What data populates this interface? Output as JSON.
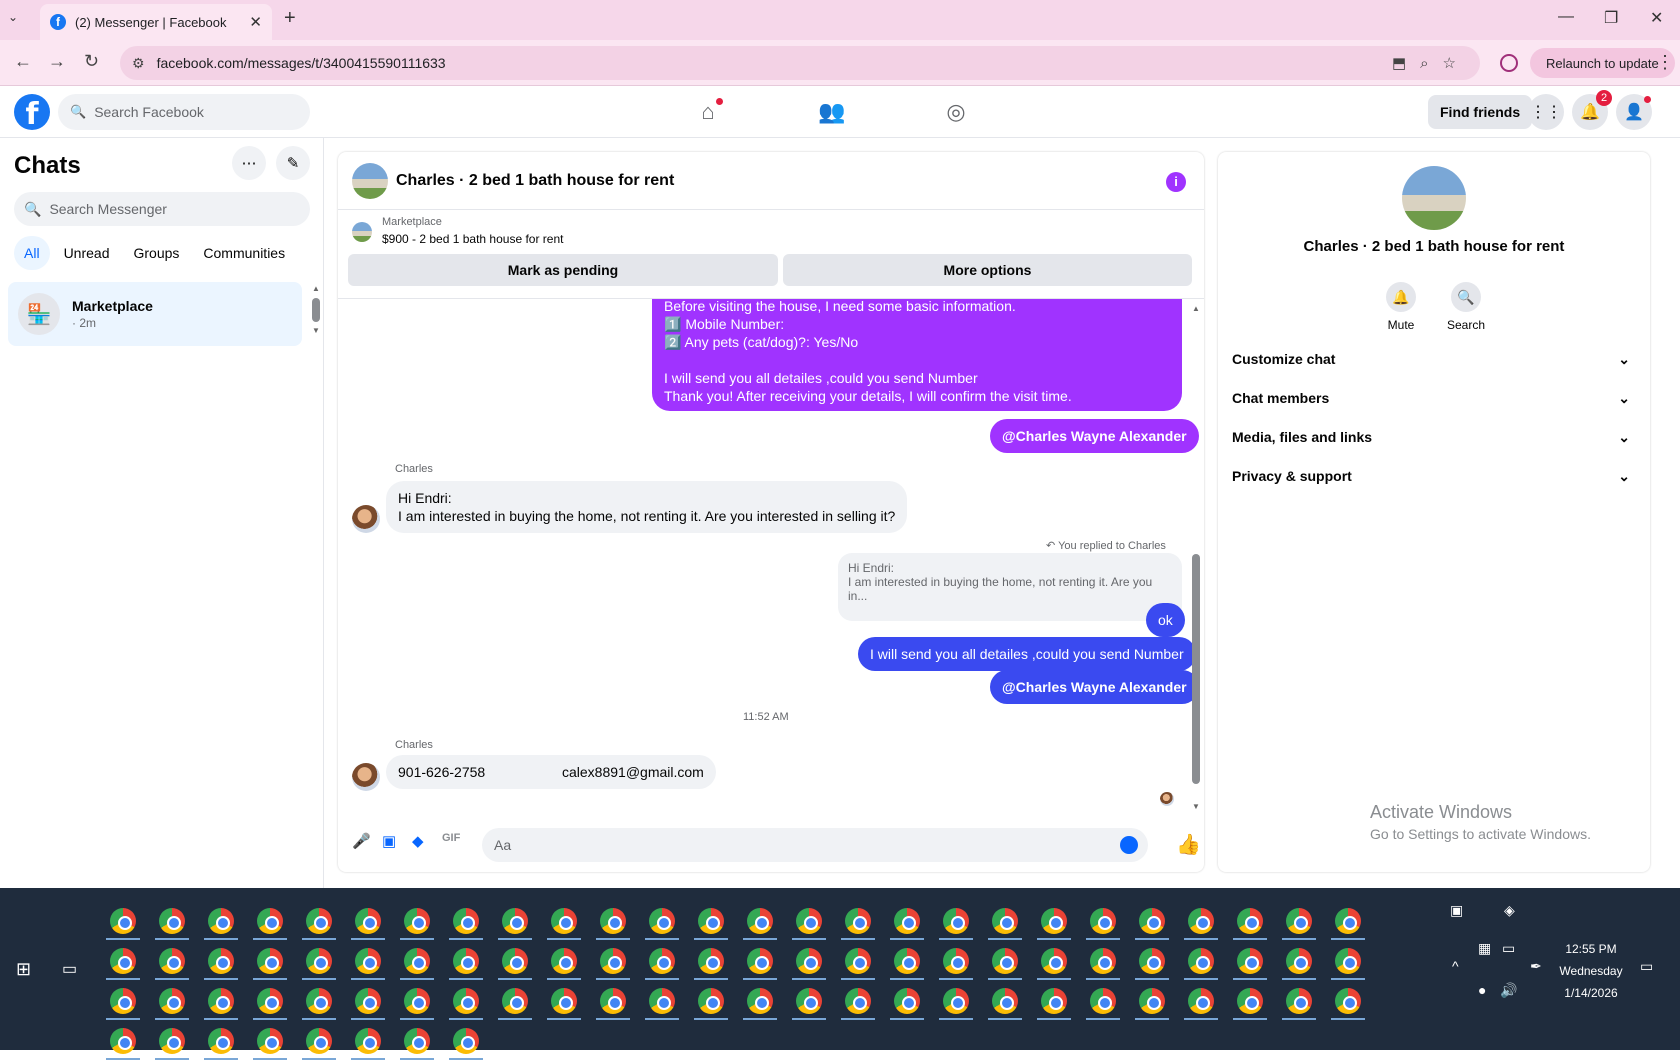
{
  "browser": {
    "tab_title": "(2) Messenger | Facebook",
    "url": "facebook.com/messages/t/3400415590111633",
    "relaunch_label": "Relaunch to update"
  },
  "fb": {
    "search_placeholder": "Search Facebook",
    "find_friends": "Find friends",
    "notification_count": "2"
  },
  "chats": {
    "title": "Chats",
    "search_placeholder": "Search Messenger",
    "filters": [
      "All",
      "Unread",
      "Groups",
      "Communities"
    ],
    "active_filter": "All",
    "items": [
      {
        "name": "Marketplace",
        "time": "· 2m"
      }
    ]
  },
  "conversation": {
    "title": "Charles · 2 bed 1 bath house for rent",
    "marketplace_label": "Marketplace",
    "listing": "$900 - 2 bed 1 bath house for rent",
    "mark_pending": "Mark as pending",
    "more_options": "More options",
    "messages": {
      "out1_lines": [
        "Before visiting the house, I need some basic information.",
        "1️⃣ Mobile Number:",
        "2️⃣ Any pets (cat/dog)?: Yes/No",
        "",
        "I will send you all detailes ,could you send Number",
        "Thank you! After receiving your details, I will confirm the visit time."
      ],
      "mention": "@Charles Wayne Alexander",
      "sender_name": "Charles",
      "in1_line1": "Hi Endri:",
      "in1_line2": "I am interested in buying the home, not renting it. Are you interested in selling it?",
      "replied_label": "You replied to Charles",
      "quoted_line1": "Hi Endri:",
      "quoted_line2": "I am interested in buying the home, not renting it. Are you in...",
      "out_ok": "ok",
      "out_send": "I will send you all detailes ,could you send Number",
      "mention2": "@Charles Wayne Alexander",
      "timestamp": "11:52 AM",
      "in2_phone": "901-626-2758",
      "in2_email": "calex8891@gmail.com"
    },
    "composer_placeholder": "Aa"
  },
  "right_panel": {
    "name": "Charles · 2 bed 1 bath house for rent",
    "mute": "Mute",
    "search": "Search",
    "sections": [
      "Customize chat",
      "Chat members",
      "Media, files and links",
      "Privacy & support"
    ]
  },
  "windows": {
    "activate_title": "Activate Windows",
    "activate_sub": "Go to Settings to activate Windows.",
    "time": "12:55 PM",
    "day": "Wednesday",
    "date": "1/14/2026"
  }
}
